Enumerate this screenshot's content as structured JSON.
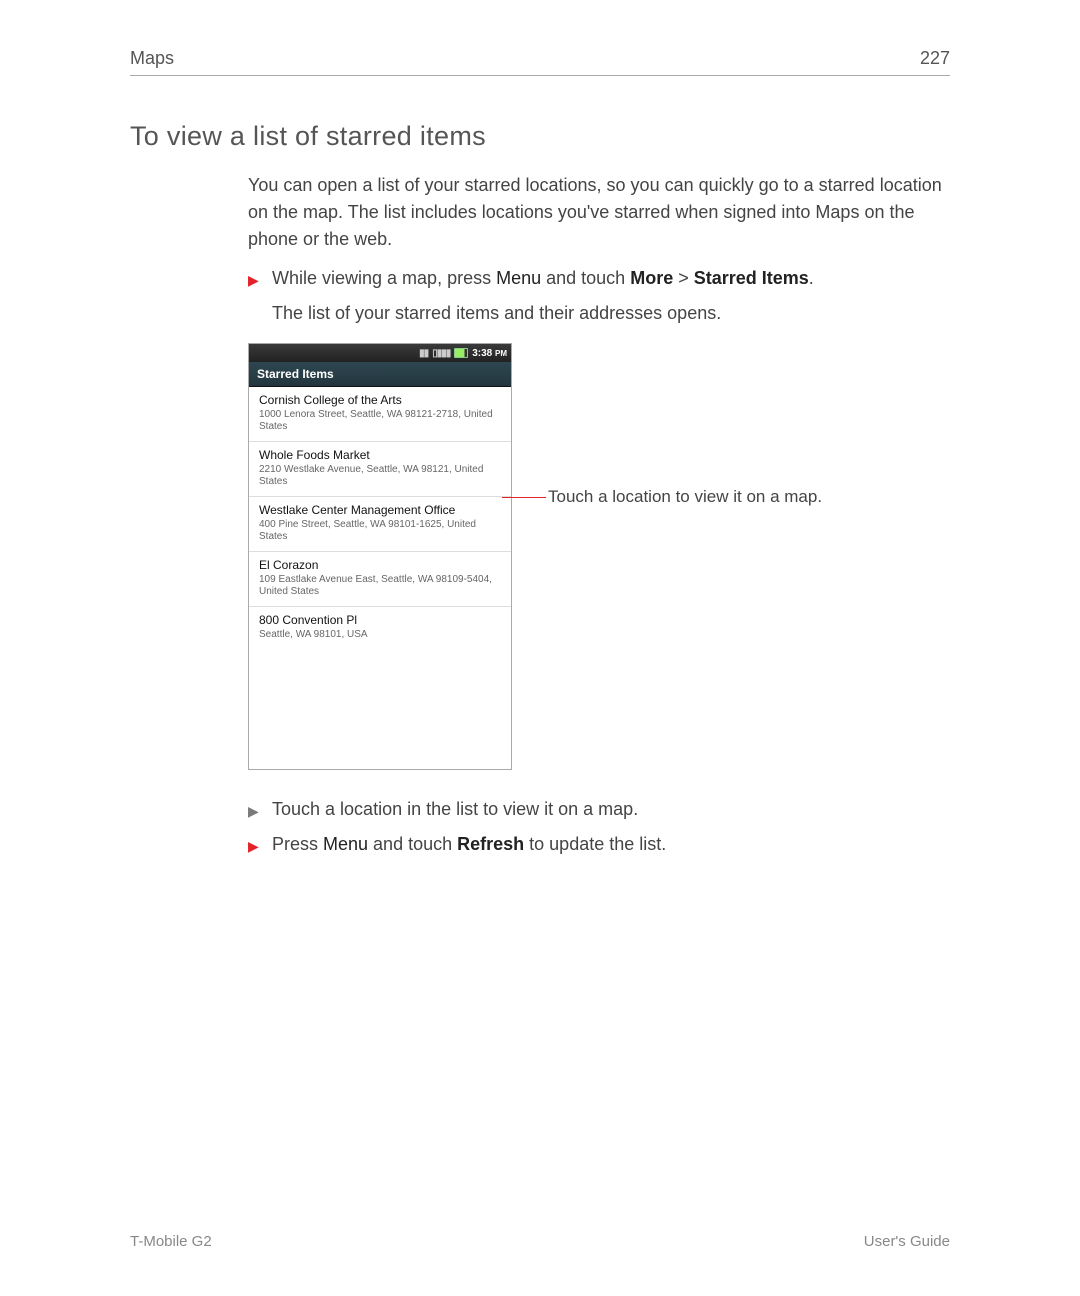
{
  "header": {
    "left": "Maps",
    "right": "227"
  },
  "section_title": "To view a list of starred items",
  "intro": "You can open a list of your starred locations, so you can quickly go to a starred location on the map. The list includes locations you've starred when signed into Maps on the phone or the web.",
  "bullet1": {
    "pre": "While viewing a map, press ",
    "menu": "Menu",
    "mid": " and touch ",
    "more": "More",
    "gt": " > ",
    "si": "Starred Items",
    "end": "."
  },
  "sub": "The list of your starred items and their addresses opens.",
  "screenshot": {
    "statusbar": {
      "time": "3:38",
      "ampm": "PM"
    },
    "listbar": "Starred Items",
    "items": [
      {
        "name": "Cornish College of the Arts",
        "addr": "1000 Lenora Street, Seattle, WA 98121-2718, United States"
      },
      {
        "name": "Whole Foods Market",
        "addr": "2210 Westlake Avenue, Seattle, WA 98121, United States"
      },
      {
        "name": "Westlake Center Management Office",
        "addr": "400 Pine Street, Seattle, WA 98101-1625, United States"
      },
      {
        "name": "El Corazon",
        "addr": "109 Eastlake Avenue East, Seattle, WA 98109-5404, United States"
      },
      {
        "name": "800 Convention Pl",
        "addr": "Seattle, WA 98101, USA"
      }
    ]
  },
  "callout": "Touch a location to view it on a map.",
  "bullet2": "Touch a location in the list to view it on a map.",
  "bullet3": {
    "pre": "Press ",
    "menu": "Menu",
    "mid": " and touch ",
    "refresh": "Refresh",
    "end": " to update the list."
  },
  "footer": {
    "left": "T-Mobile G2",
    "right": "User's Guide"
  }
}
